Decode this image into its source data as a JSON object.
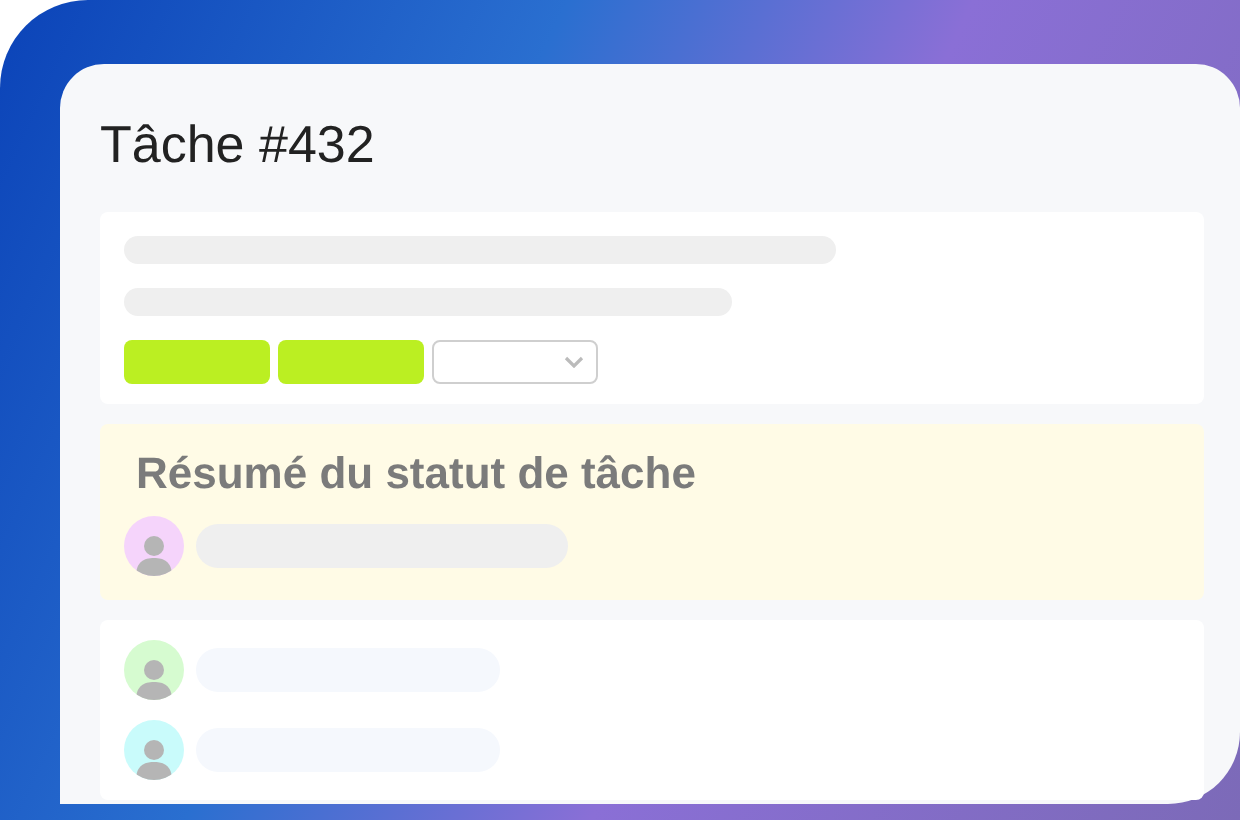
{
  "title": "Tâche #432",
  "summary": {
    "title": "Résumé du statut de tâche",
    "people": [
      {
        "color": "#f5d4fb"
      }
    ]
  },
  "assignees": [
    {
      "color": "#d6fbd0"
    },
    {
      "color": "#c9fbfb"
    }
  ]
}
